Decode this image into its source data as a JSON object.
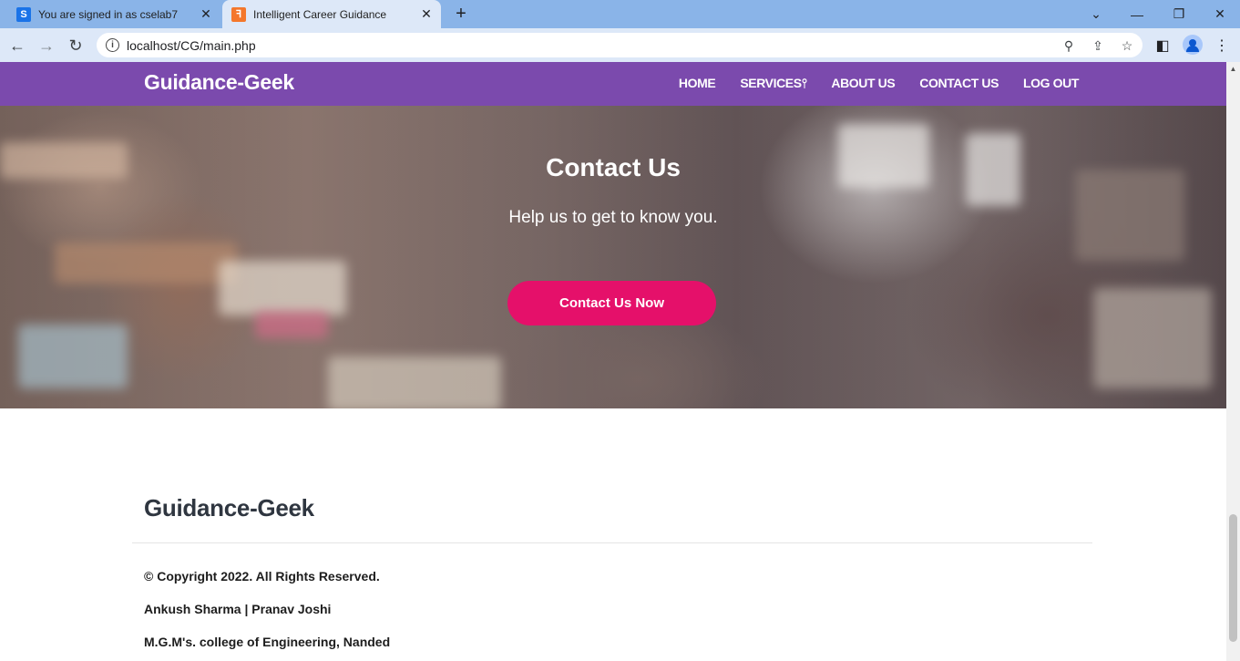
{
  "browser": {
    "tabs": [
      {
        "label": "You are signed in as cselab7",
        "icon": "S",
        "active": false
      },
      {
        "label": "Intelligent Career Guidance",
        "icon": "ꟻ",
        "active": true
      }
    ],
    "new_tab_icon": "+",
    "url": "localhost/CG/main.php"
  },
  "site": {
    "brand": "Guidance-Geek",
    "nav": [
      "HOME",
      "SERVICES⫯",
      "ABOUT US",
      "CONTACT US",
      "LOG OUT"
    ]
  },
  "hero": {
    "title": "Contact Us",
    "subtitle": "Help us to get to know you.",
    "button": "Contact Us Now"
  },
  "footer": {
    "brand": "Guidance-Geek",
    "copyright": "© Copyright 2022. All Rights Reserved.",
    "authors": "Ankush Sharma | Pranav Joshi",
    "college": "M.G.M's. college of Engineering, Nanded"
  },
  "colors": {
    "navbar": "#7b4aad",
    "button": "#e5106a",
    "tabbar": "#8ab4e8"
  }
}
